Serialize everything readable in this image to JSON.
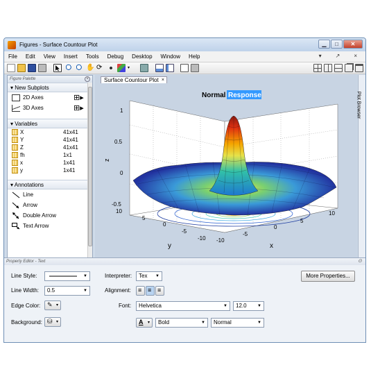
{
  "window": {
    "title": "Figures - Surface Countour Plot"
  },
  "window_controls": {
    "minimize": "▁",
    "maximize": "□",
    "close": "✕"
  },
  "menu": {
    "items": [
      "File",
      "Edit",
      "View",
      "Insert",
      "Tools",
      "Debug",
      "Desktop",
      "Window",
      "Help"
    ],
    "right_glyphs": [
      "▾",
      "↗",
      "×"
    ]
  },
  "palette": {
    "title": "Figure Palette",
    "new_subplots": {
      "header": "New Subplots",
      "items": [
        "2D Axes",
        "3D Axes"
      ]
    },
    "variables": {
      "header": "Variables",
      "items": [
        {
          "name": "X",
          "size": "41x41"
        },
        {
          "name": "Y",
          "size": "41x41"
        },
        {
          "name": "Z",
          "size": "41x41"
        },
        {
          "name": "fh",
          "size": "1x1"
        },
        {
          "name": "x",
          "size": "1x41"
        },
        {
          "name": "y",
          "size": "1x41"
        }
      ]
    },
    "annotations": {
      "header": "Annotations",
      "items": [
        "Line",
        "Arrow",
        "Double Arrow",
        "Text Arrow"
      ]
    }
  },
  "tab": {
    "label": "Surface Countour Plot",
    "close": "×"
  },
  "plot": {
    "title_normal": "Normal",
    "title_highlight": "Response",
    "zlabel": "z",
    "xlabel": "x",
    "ylabel": "y",
    "zticks": [
      "1",
      "0.5",
      "0",
      "-0.5"
    ],
    "xticks": [
      "-10",
      "-5",
      "0",
      "5",
      "10"
    ],
    "yticks": [
      "10",
      "5",
      "0",
      "-5",
      "-10"
    ]
  },
  "plot_browser": {
    "label": "Plot Browser"
  },
  "property_editor": {
    "title": "Property Editor - Text",
    "line_style_label": "Line Style:",
    "line_width_label": "Line Width:",
    "line_width_value": "0.5",
    "edge_color_label": "Edge Color:",
    "background_label": "Background:",
    "interpreter_label": "Interpreter:",
    "interpreter_value": "Tex",
    "alignment_label": "Alignment:",
    "font_label": "Font:",
    "font_name": "Helvetica",
    "font_size": "12.0",
    "font_weight": "Bold",
    "font_angle": "Normal",
    "more_properties": "More Properties..."
  }
}
